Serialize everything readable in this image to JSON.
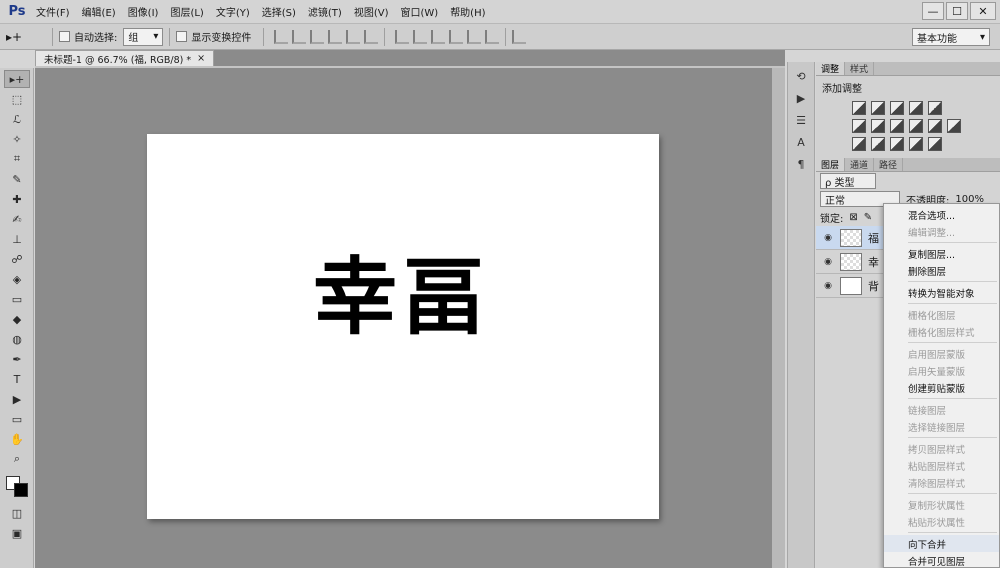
{
  "app": {
    "logo": "Ps"
  },
  "menu": [
    "文件(F)",
    "编辑(E)",
    "图像(I)",
    "图层(L)",
    "文字(Y)",
    "选择(S)",
    "滤镜(T)",
    "视图(V)",
    "窗口(W)",
    "帮助(H)"
  ],
  "window_controls": {
    "minimize": "—",
    "maximize": "☐",
    "close": "✕"
  },
  "options": {
    "tool_glyph": "▸+",
    "auto_select_label": "自动选择:",
    "auto_select_value": "组",
    "show_transform_label": "显示变换控件",
    "workspace": "基本功能"
  },
  "document": {
    "tab_title": "未标题-1 @ 66.7% (福, RGB/8) *",
    "tab_close": "×",
    "text_glyph_1": "幸",
    "text_glyph_2": "畐"
  },
  "tools": [
    "▸+",
    "⬚",
    "ℒ",
    "✧",
    "⌗",
    "✎",
    "✚",
    "✍",
    "⊥",
    "☍",
    "◈",
    "▭",
    "◆",
    "◍",
    "✒",
    "T",
    "▶",
    "▭",
    "✋",
    "⌕"
  ],
  "panels": {
    "adjust_tabs": [
      "调整",
      "样式"
    ],
    "adjust_title": "添加调整",
    "layer_tabs": [
      "图层",
      "通道",
      "路径"
    ],
    "kind_label": "ρ 类型",
    "blend_mode": "正常",
    "opacity_label": "不透明度:",
    "opacity_value": "100%",
    "lock_label": "锁定:",
    "layers": [
      {
        "name": "福",
        "selected": true
      },
      {
        "name": "幸",
        "selected": false
      },
      {
        "name": "背",
        "selected": false
      }
    ]
  },
  "context_menu": {
    "items": [
      {
        "label": "混合选项...",
        "disabled": false
      },
      {
        "label": "编辑调整...",
        "disabled": true
      },
      {
        "sep": true
      },
      {
        "label": "复制图层...",
        "disabled": false
      },
      {
        "label": "删除图层",
        "disabled": false
      },
      {
        "sep": true
      },
      {
        "label": "转换为智能对象",
        "disabled": false
      },
      {
        "sep": true
      },
      {
        "label": "栅格化图层",
        "disabled": true
      },
      {
        "label": "栅格化图层样式",
        "disabled": true
      },
      {
        "sep": true
      },
      {
        "label": "启用图层蒙版",
        "disabled": true
      },
      {
        "label": "启用矢量蒙版",
        "disabled": true
      },
      {
        "label": "创建剪贴蒙版",
        "disabled": false
      },
      {
        "sep": true
      },
      {
        "label": "链接图层",
        "disabled": true
      },
      {
        "label": "选择链接图层",
        "disabled": true
      },
      {
        "sep": true
      },
      {
        "label": "拷贝图层样式",
        "disabled": true
      },
      {
        "label": "粘贴图层样式",
        "disabled": true
      },
      {
        "label": "清除图层样式",
        "disabled": true
      },
      {
        "sep": true
      },
      {
        "label": "复制形状属性",
        "disabled": true
      },
      {
        "label": "粘贴形状属性",
        "disabled": true
      },
      {
        "sep": true
      },
      {
        "label": "向下合并",
        "disabled": false,
        "hover": true
      },
      {
        "label": "合并可见图层",
        "disabled": false
      }
    ]
  }
}
